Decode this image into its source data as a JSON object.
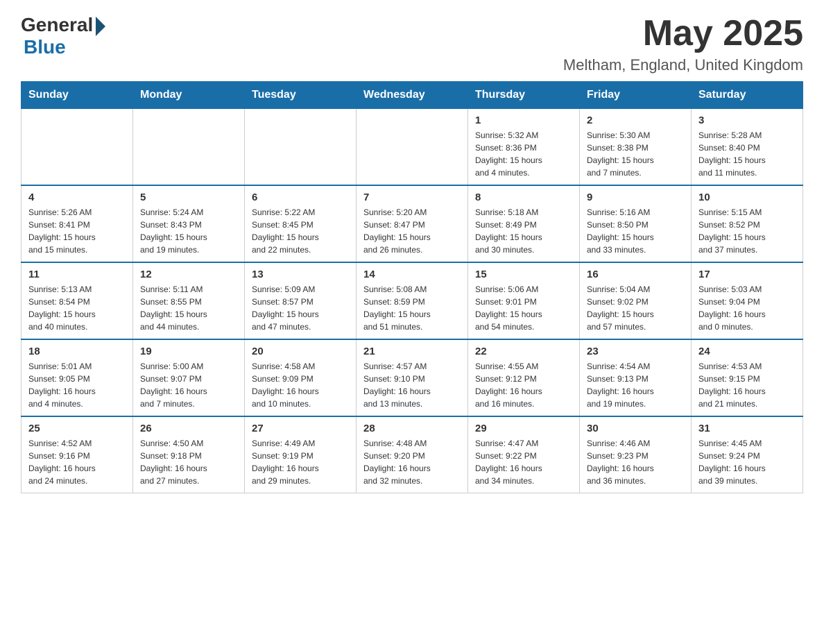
{
  "header": {
    "logo_general": "General",
    "logo_blue": "Blue",
    "month_title": "May 2025",
    "location": "Meltham, England, United Kingdom"
  },
  "days_of_week": [
    "Sunday",
    "Monday",
    "Tuesday",
    "Wednesday",
    "Thursday",
    "Friday",
    "Saturday"
  ],
  "weeks": [
    [
      {
        "day": "",
        "info": ""
      },
      {
        "day": "",
        "info": ""
      },
      {
        "day": "",
        "info": ""
      },
      {
        "day": "",
        "info": ""
      },
      {
        "day": "1",
        "info": "Sunrise: 5:32 AM\nSunset: 8:36 PM\nDaylight: 15 hours\nand 4 minutes."
      },
      {
        "day": "2",
        "info": "Sunrise: 5:30 AM\nSunset: 8:38 PM\nDaylight: 15 hours\nand 7 minutes."
      },
      {
        "day": "3",
        "info": "Sunrise: 5:28 AM\nSunset: 8:40 PM\nDaylight: 15 hours\nand 11 minutes."
      }
    ],
    [
      {
        "day": "4",
        "info": "Sunrise: 5:26 AM\nSunset: 8:41 PM\nDaylight: 15 hours\nand 15 minutes."
      },
      {
        "day": "5",
        "info": "Sunrise: 5:24 AM\nSunset: 8:43 PM\nDaylight: 15 hours\nand 19 minutes."
      },
      {
        "day": "6",
        "info": "Sunrise: 5:22 AM\nSunset: 8:45 PM\nDaylight: 15 hours\nand 22 minutes."
      },
      {
        "day": "7",
        "info": "Sunrise: 5:20 AM\nSunset: 8:47 PM\nDaylight: 15 hours\nand 26 minutes."
      },
      {
        "day": "8",
        "info": "Sunrise: 5:18 AM\nSunset: 8:49 PM\nDaylight: 15 hours\nand 30 minutes."
      },
      {
        "day": "9",
        "info": "Sunrise: 5:16 AM\nSunset: 8:50 PM\nDaylight: 15 hours\nand 33 minutes."
      },
      {
        "day": "10",
        "info": "Sunrise: 5:15 AM\nSunset: 8:52 PM\nDaylight: 15 hours\nand 37 minutes."
      }
    ],
    [
      {
        "day": "11",
        "info": "Sunrise: 5:13 AM\nSunset: 8:54 PM\nDaylight: 15 hours\nand 40 minutes."
      },
      {
        "day": "12",
        "info": "Sunrise: 5:11 AM\nSunset: 8:55 PM\nDaylight: 15 hours\nand 44 minutes."
      },
      {
        "day": "13",
        "info": "Sunrise: 5:09 AM\nSunset: 8:57 PM\nDaylight: 15 hours\nand 47 minutes."
      },
      {
        "day": "14",
        "info": "Sunrise: 5:08 AM\nSunset: 8:59 PM\nDaylight: 15 hours\nand 51 minutes."
      },
      {
        "day": "15",
        "info": "Sunrise: 5:06 AM\nSunset: 9:01 PM\nDaylight: 15 hours\nand 54 minutes."
      },
      {
        "day": "16",
        "info": "Sunrise: 5:04 AM\nSunset: 9:02 PM\nDaylight: 15 hours\nand 57 minutes."
      },
      {
        "day": "17",
        "info": "Sunrise: 5:03 AM\nSunset: 9:04 PM\nDaylight: 16 hours\nand 0 minutes."
      }
    ],
    [
      {
        "day": "18",
        "info": "Sunrise: 5:01 AM\nSunset: 9:05 PM\nDaylight: 16 hours\nand 4 minutes."
      },
      {
        "day": "19",
        "info": "Sunrise: 5:00 AM\nSunset: 9:07 PM\nDaylight: 16 hours\nand 7 minutes."
      },
      {
        "day": "20",
        "info": "Sunrise: 4:58 AM\nSunset: 9:09 PM\nDaylight: 16 hours\nand 10 minutes."
      },
      {
        "day": "21",
        "info": "Sunrise: 4:57 AM\nSunset: 9:10 PM\nDaylight: 16 hours\nand 13 minutes."
      },
      {
        "day": "22",
        "info": "Sunrise: 4:55 AM\nSunset: 9:12 PM\nDaylight: 16 hours\nand 16 minutes."
      },
      {
        "day": "23",
        "info": "Sunrise: 4:54 AM\nSunset: 9:13 PM\nDaylight: 16 hours\nand 19 minutes."
      },
      {
        "day": "24",
        "info": "Sunrise: 4:53 AM\nSunset: 9:15 PM\nDaylight: 16 hours\nand 21 minutes."
      }
    ],
    [
      {
        "day": "25",
        "info": "Sunrise: 4:52 AM\nSunset: 9:16 PM\nDaylight: 16 hours\nand 24 minutes."
      },
      {
        "day": "26",
        "info": "Sunrise: 4:50 AM\nSunset: 9:18 PM\nDaylight: 16 hours\nand 27 minutes."
      },
      {
        "day": "27",
        "info": "Sunrise: 4:49 AM\nSunset: 9:19 PM\nDaylight: 16 hours\nand 29 minutes."
      },
      {
        "day": "28",
        "info": "Sunrise: 4:48 AM\nSunset: 9:20 PM\nDaylight: 16 hours\nand 32 minutes."
      },
      {
        "day": "29",
        "info": "Sunrise: 4:47 AM\nSunset: 9:22 PM\nDaylight: 16 hours\nand 34 minutes."
      },
      {
        "day": "30",
        "info": "Sunrise: 4:46 AM\nSunset: 9:23 PM\nDaylight: 16 hours\nand 36 minutes."
      },
      {
        "day": "31",
        "info": "Sunrise: 4:45 AM\nSunset: 9:24 PM\nDaylight: 16 hours\nand 39 minutes."
      }
    ]
  ]
}
